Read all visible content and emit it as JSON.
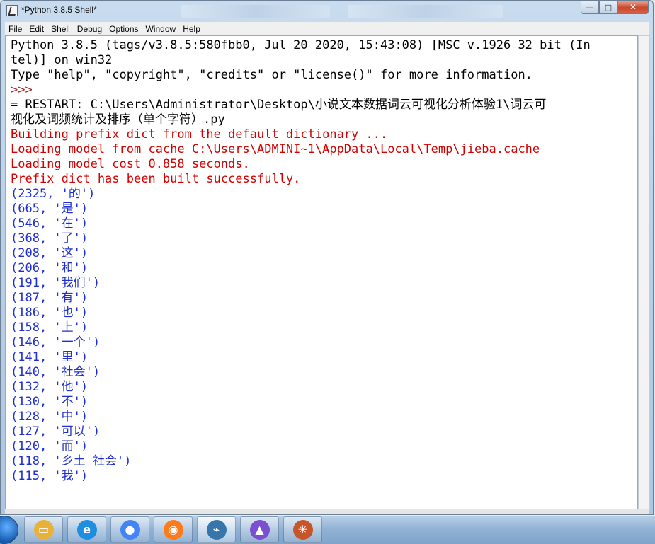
{
  "window": {
    "title": "*Python 3.8.5 Shell*"
  },
  "menu": [
    {
      "label": "File",
      "key": "F",
      "rest": "ile"
    },
    {
      "label": "Edit",
      "key": "E",
      "rest": "dit"
    },
    {
      "label": "Shell",
      "key": "S",
      "rest": "hell"
    },
    {
      "label": "Debug",
      "key": "D",
      "rest": "ebug"
    },
    {
      "label": "Options",
      "key": "O",
      "rest": "ptions"
    },
    {
      "label": "Window",
      "key": "W",
      "rest": "indow"
    },
    {
      "label": "Help",
      "key": "H",
      "rest": "elp"
    }
  ],
  "shell": {
    "lines": [
      {
        "text": "Python 3.8.5 (tags/v3.8.5:580fbb0, Jul 20 2020, 15:43:08) [MSC v.1926 32 bit (In",
        "color": "black"
      },
      {
        "text": "tel)] on win32",
        "color": "black"
      },
      {
        "text": "Type \"help\", \"copyright\", \"credits\" or \"license()\" for more information.",
        "color": "black"
      },
      {
        "text": ">>> ",
        "color": "prompt"
      },
      {
        "text": "= RESTART: C:\\Users\\Administrator\\Desktop\\小说文本数据词云可视化分析体验1\\词云可",
        "color": "black"
      },
      {
        "text": "视化及词频统计及排序（单个字符）.py",
        "color": "black"
      },
      {
        "text": "Building prefix dict from the default dictionary ...",
        "color": "red"
      },
      {
        "text": "Loading model from cache C:\\Users\\ADMINI~1\\AppData\\Local\\Temp\\jieba.cache",
        "color": "red"
      },
      {
        "text": "Loading model cost 0.858 seconds.",
        "color": "red"
      },
      {
        "text": "Prefix dict has been built successfully.",
        "color": "red"
      },
      {
        "text": "(2325, '的')",
        "color": "blue"
      },
      {
        "text": "(665, '是')",
        "color": "blue"
      },
      {
        "text": "(546, '在')",
        "color": "blue"
      },
      {
        "text": "(368, '了')",
        "color": "blue"
      },
      {
        "text": "(208, '这')",
        "color": "blue"
      },
      {
        "text": "(206, '和')",
        "color": "blue"
      },
      {
        "text": "(191, '我们')",
        "color": "blue"
      },
      {
        "text": "(187, '有')",
        "color": "blue"
      },
      {
        "text": "(186, '也')",
        "color": "blue"
      },
      {
        "text": "(158, '上')",
        "color": "blue"
      },
      {
        "text": "(146, '一个')",
        "color": "blue"
      },
      {
        "text": "(141, '里')",
        "color": "blue"
      },
      {
        "text": "(140, '社会')",
        "color": "blue"
      },
      {
        "text": "(132, '他')",
        "color": "blue"
      },
      {
        "text": "(130, '不')",
        "color": "blue"
      },
      {
        "text": "(128, '中')",
        "color": "blue"
      },
      {
        "text": "(127, '可以')",
        "color": "blue"
      },
      {
        "text": "(120, '而')",
        "color": "blue"
      },
      {
        "text": "(118, '乡土 社会')",
        "color": "blue"
      },
      {
        "text": "(115, '我')",
        "color": "blue"
      }
    ]
  },
  "colors": {
    "stdout": "#1f2fd0",
    "stderr": "#d40000",
    "prompt": "#a52a2a",
    "text": "#000000"
  },
  "taskbar": {
    "items": [
      {
        "icon": "file-explorer-icon",
        "color": "#e8b23a",
        "active": false
      },
      {
        "icon": "internet-explorer-icon",
        "color": "#1e8fe0",
        "active": false
      },
      {
        "icon": "chrome-icon",
        "color": "#4285f4",
        "active": false
      },
      {
        "icon": "firefox-icon",
        "color": "#ff7a1a",
        "active": false
      },
      {
        "icon": "python-idle-icon",
        "color": "#3776ab",
        "active": true
      },
      {
        "icon": "app-icon",
        "color": "#7a4fd0",
        "active": false
      },
      {
        "icon": "app-icon-2",
        "color": "#c8552a",
        "active": false
      }
    ]
  }
}
